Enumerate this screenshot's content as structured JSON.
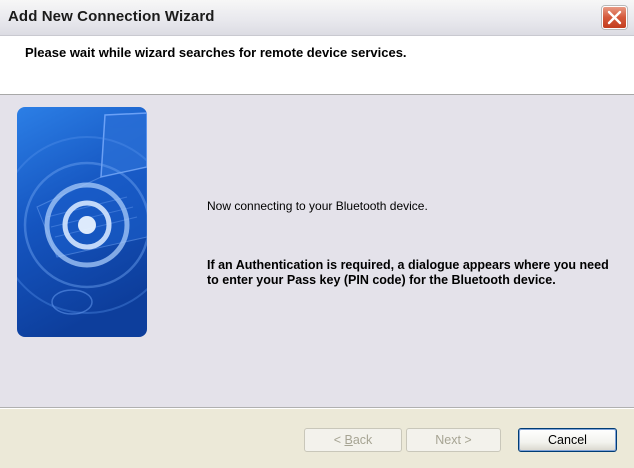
{
  "window": {
    "title": "Add New Connection Wizard"
  },
  "header": {
    "text": "Please wait while wizard searches for remote device services."
  },
  "body": {
    "status_text": "Now connecting to your Bluetooth device.",
    "auth_note": "If an Authentication is required, a dialogue appears where you need to enter your Pass key (PIN code) for the Bluetooth device."
  },
  "buttons": {
    "back": {
      "mnemonic": "B",
      "rest": "ack",
      "prefix": "< ",
      "enabled": false
    },
    "next": {
      "label": "Next >",
      "enabled": false
    },
    "cancel": {
      "label": "Cancel",
      "enabled": true
    }
  },
  "colors": {
    "title_bar": "#e9e9ee",
    "close_button": "#d4583a",
    "image_blue": "#1f5cc8",
    "dialog_bg": "#e4e2ea"
  },
  "icons": {
    "close": "close-icon",
    "wizard_image": "bluetooth-laptop-illustration"
  }
}
